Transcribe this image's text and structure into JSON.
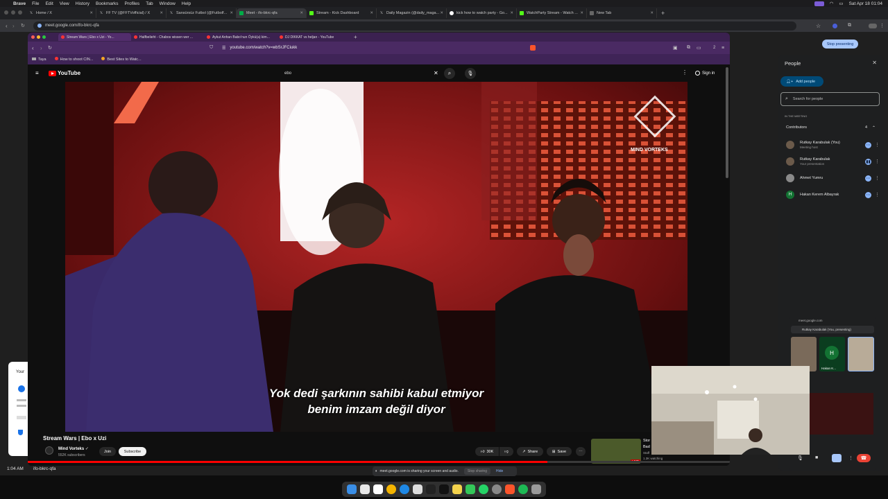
{
  "menubar": {
    "app": "Brave",
    "items": [
      "File",
      "Edit",
      "View",
      "History",
      "Bookmarks",
      "Profiles",
      "Tab",
      "Window",
      "Help"
    ],
    "clock": "Sat Apr 18  01:04"
  },
  "outer_browser": {
    "tabs": [
      {
        "label": "Home / X",
        "icon": "x-icon",
        "active": false
      },
      {
        "label": "FF TV (@FFTVofficial) / X",
        "icon": "x-icon",
        "active": false
      },
      {
        "label": "Sansürsüz Futbol (@Futbolf...",
        "icon": "x-icon",
        "active": false
      },
      {
        "label": "Meet - ifo-bkrc-qfa",
        "icon": "meet-icon",
        "active": true
      },
      {
        "label": "Stream - Kick Dashboard",
        "icon": "kick-icon",
        "active": false
      },
      {
        "label": "Daily Magazin (@daily_maga...",
        "icon": "x-icon",
        "active": false
      },
      {
        "label": "kick how to watch party - Go...",
        "icon": "google-icon",
        "active": false
      },
      {
        "label": "WatchParty Stream - Watch ...",
        "icon": "kick-icon",
        "active": false
      },
      {
        "label": "New Tab",
        "icon": "newtab-icon",
        "active": false
      }
    ],
    "url": "meet.google.com/ifo-bkrc-qfa"
  },
  "inner_browser": {
    "tabs": [
      {
        "label": "Stream Wars | Ebo x Uzi - Yo...",
        "active": true
      },
      {
        "label": "Halfbelieht - Chabos wissen wer ...",
        "active": false
      },
      {
        "label": "Aykut Anhan Babo'nun Öykü(a) kim...",
        "active": false
      },
      {
        "label": "DJ DIKKAT vs heljan - YouTube",
        "active": false
      }
    ],
    "url": "youtube.com/watch?v=wbSrJFCiukk",
    "bookmarks": [
      "Taya",
      "How to shoot CIN...",
      "Best Sites to Watc..."
    ],
    "tab_count": "2"
  },
  "youtube": {
    "logo": "YouTube",
    "search_value": "ebo",
    "sign_in": "Sign in",
    "video_title": "Stream Wars | Ebo x Uzi",
    "channel": "Mind Vorteks",
    "subscribers": "552K subscribers",
    "join": "Join",
    "subscribe": "Subscribe",
    "likes": "30K",
    "share": "Share",
    "save": "Save",
    "subtitle_line1": "Yok dedi şarkının sahibi kabul etmiyor",
    "subtitle_line2": "benim imzam değil diyor",
    "watermark": "MIND VORTEKS",
    "progress": 0.74,
    "up_next": {
      "title": "Stor",
      "sub": "Bad",
      "channel": "Staff",
      "watching": "1.3K watching",
      "badge": "LIVE"
    }
  },
  "meet": {
    "stop_presenting": "Stop presenting",
    "panel_title": "People",
    "add_people": "Add people",
    "search_placeholder": "Search for people",
    "in_meeting": "IN THE MEETING",
    "contributors_label": "Contributors",
    "contributors_count": "4",
    "people": [
      {
        "name": "Rutkay Karabulak (You)",
        "sub": "Meeting host",
        "avatar": "photo"
      },
      {
        "name": "Rutkay Karabulak",
        "sub": "Your presentation",
        "avatar": "photo"
      },
      {
        "name": "Ahmet Yumru",
        "sub": "",
        "avatar": "photo"
      },
      {
        "name": "Hakan Kerem Albayrak",
        "sub": "",
        "avatar": "H"
      }
    ],
    "pip_url": "meet.google.com",
    "pip_presenter": "Rutkay Karabulak (You, presenting)",
    "pip_tile_name": "Hakan K...",
    "pip_tile_letter": "H",
    "share_notice": "meet.google.com is sharing your screen and audio.",
    "stop_sharing": "Stop sharing",
    "hide": "Hide",
    "time": "1:04 AM",
    "meeting_code": "ifo-bkrc-qfa",
    "side_card_title": "Your"
  },
  "colors": {
    "accent": "#8ab4f8",
    "yt_red": "#ff0000",
    "end_call": "#ea4335",
    "inner_chrome": "#4a2a63"
  }
}
